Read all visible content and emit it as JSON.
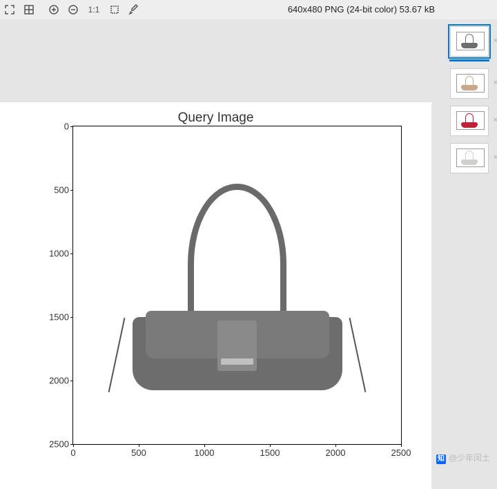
{
  "toolbar": {
    "tools": [
      "fullscreen",
      "grid",
      "zoom-in",
      "zoom-out",
      "one-to-one",
      "crop",
      "eyedropper"
    ],
    "one_to_one_label": "1:1"
  },
  "image_info": "640x480 PNG (24-bit color) 53.67 kB",
  "chart_data": {
    "type": "image",
    "title": "Query Image",
    "xlim": [
      0,
      2500
    ],
    "ylim": [
      2500,
      0
    ],
    "xticks": [
      0,
      500,
      1000,
      1500,
      2000,
      2500
    ],
    "yticks": [
      0,
      500,
      1000,
      1500,
      2000,
      2500
    ],
    "content": "gray handbag product photo"
  },
  "thumbnails": [
    {
      "id": "thumb-1",
      "color": "#6d6d6d",
      "selected": true
    },
    {
      "id": "thumb-2",
      "color": "#c9a78a",
      "selected": false
    },
    {
      "id": "thumb-3",
      "color": "#c41e3a",
      "selected": false
    },
    {
      "id": "thumb-4",
      "color": "#d0d0cc",
      "selected": false
    }
  ],
  "watermark": {
    "icon": "知",
    "text": "@少年闰土"
  }
}
